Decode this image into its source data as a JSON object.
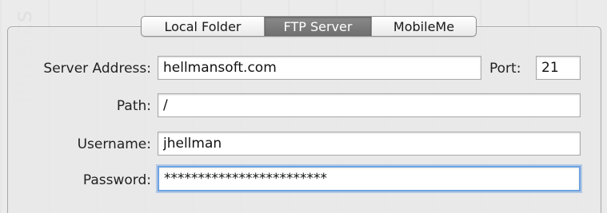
{
  "tabs": [
    {
      "label": "Local Folder",
      "selected": false
    },
    {
      "label": "FTP Server",
      "selected": true
    },
    {
      "label": "MobileMe",
      "selected": false
    }
  ],
  "form": {
    "server_address": {
      "label": "Server Address:",
      "value": "hellmansoft.com"
    },
    "port": {
      "label": "Port:",
      "value": "21"
    },
    "path": {
      "label": "Path:",
      "value": "/"
    },
    "username": {
      "label": "Username:",
      "value": "jhellman"
    },
    "password": {
      "label": "Password:",
      "value": "************************"
    }
  },
  "colors": {
    "active_tab": "#7d7d7d",
    "focus_ring": "#6ea2e0"
  }
}
